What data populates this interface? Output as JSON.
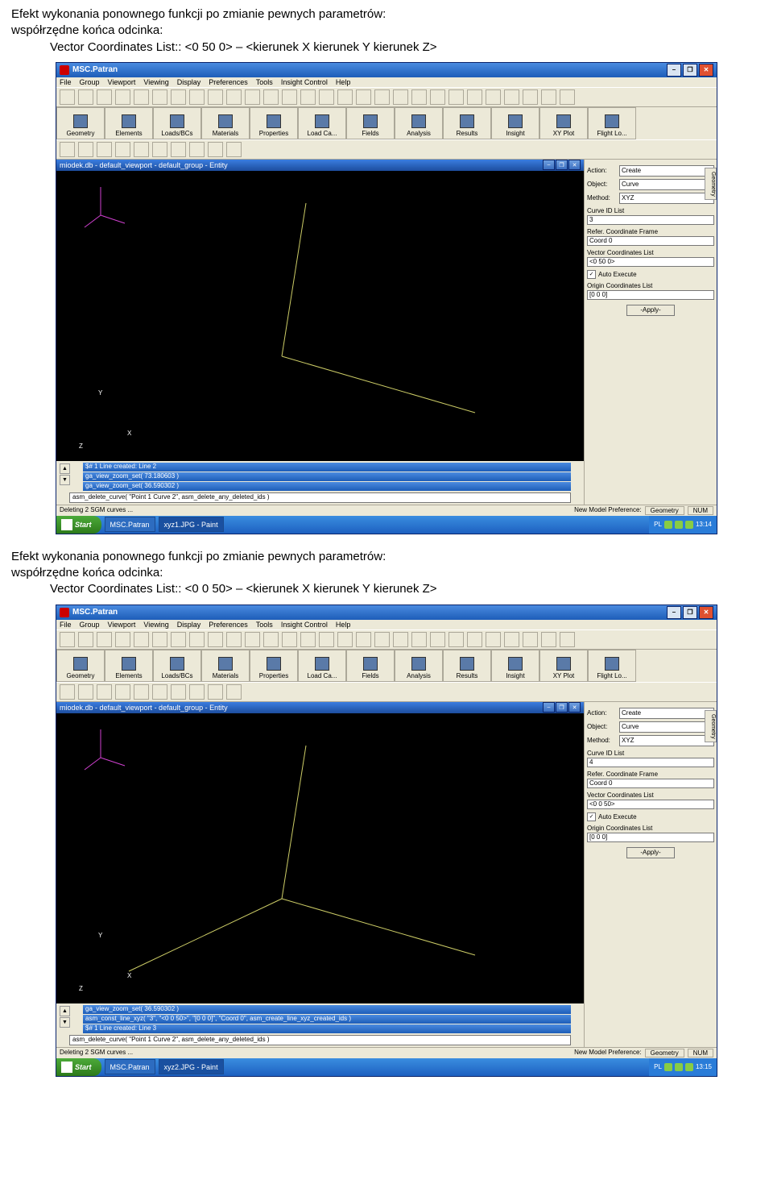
{
  "doc": {
    "intro1": "Efekt wykonania ponownego funkcji po zmianie pewnych parametrów:",
    "coord_line": "współrzędne końca odcinka:",
    "vec1": "Vector Coordinates List:: <0 50 0> – <kierunek X kierunek Y kierunek Z>",
    "intro2": "Efekt wykonania ponownego funkcji po zmianie pewnych parametrów:",
    "vec2": "Vector Coordinates List:: <0 0 50> – <kierunek X kierunek Y kierunek Z>"
  },
  "app": {
    "title": "MSC.Patran",
    "menus": [
      "File",
      "Group",
      "Viewport",
      "Viewing",
      "Display",
      "Preferences",
      "Tools",
      "Insight Control",
      "Help"
    ],
    "tabs": [
      "Geometry",
      "Elements",
      "Loads/BCs",
      "Materials",
      "Properties",
      "Load Ca...",
      "Fields",
      "Analysis",
      "Results",
      "Insight",
      "XY Plot",
      "Flight Lo..."
    ]
  },
  "viewport": {
    "title": "miodek.db - default_viewport - default_group - Entity"
  },
  "shot1": {
    "history": {
      "h1": "$# 1 Line created: Line 2",
      "h2": "ga_view_zoom_set( 73.180603 )",
      "h3": "ga_view_zoom_set( 36.590302 )",
      "cmd": "asm_delete_curve( \"Point 1 Curve 2\", asm_delete_any_deleted_ids )"
    },
    "status": {
      "left": "Deleting 2 SGM curves ...",
      "pref": "New Model Preference:",
      "pref_val": "Geometry",
      "num": "NUM"
    },
    "panel": {
      "action_label": "Action:",
      "action": "Create",
      "object_label": "Object:",
      "object": "Curve",
      "method_label": "Method:",
      "method": "XYZ",
      "curve_id_label": "Curve ID List",
      "curve_id": "3",
      "refer_label": "Refer. Coordinate Frame",
      "refer": "Coord 0",
      "vec_label": "Vector Coordinates List",
      "vec": "<0 50 0>",
      "auto_exec": "Auto Execute",
      "origin_label": "Origin Coordinates List",
      "origin": "[0 0 0]",
      "apply": "-Apply-"
    },
    "taskbar": {
      "start": "Start",
      "item1": "MSC.Patran",
      "item2": "xyz1.JPG - Paint",
      "lang": "PL",
      "time": "13:14"
    }
  },
  "shot2": {
    "history": {
      "h1": "ga_view_zoom_set( 36.590302 )",
      "h2": "asm_const_line_xyz( \"3\", \"<0 0 50>\", \"[0 0 0]\", \"Coord 0\", asm_create_line_xyz_created_ids )",
      "h3": "$# 1 Line created: Line 3",
      "cmd": "asm_delete_curve( \"Point 1 Curve 2\", asm_delete_any_deleted_ids )"
    },
    "status": {
      "left": "Deleting 2 SGM curves ...",
      "pref": "New Model Preference:",
      "pref_val": "Geometry",
      "num": "NUM"
    },
    "panel": {
      "action_label": "Action:",
      "action": "Create",
      "object_label": "Object:",
      "object": "Curve",
      "method_label": "Method:",
      "method": "XYZ",
      "curve_id_label": "Curve ID List",
      "curve_id": "4",
      "refer_label": "Refer. Coordinate Frame",
      "refer": "Coord 0",
      "vec_label": "Vector Coordinates List",
      "vec": "<0 0 50>",
      "auto_exec": "Auto Execute",
      "origin_label": "Origin Coordinates List",
      "origin": "[0 0 0]",
      "apply": "-Apply-"
    },
    "taskbar": {
      "start": "Start",
      "item1": "MSC.Patran",
      "item2": "xyz2.JPG - Paint",
      "lang": "PL",
      "time": "13:15"
    }
  },
  "axes": {
    "x": "X",
    "y": "Y",
    "z": "Z"
  },
  "side_tab": "Geometry"
}
